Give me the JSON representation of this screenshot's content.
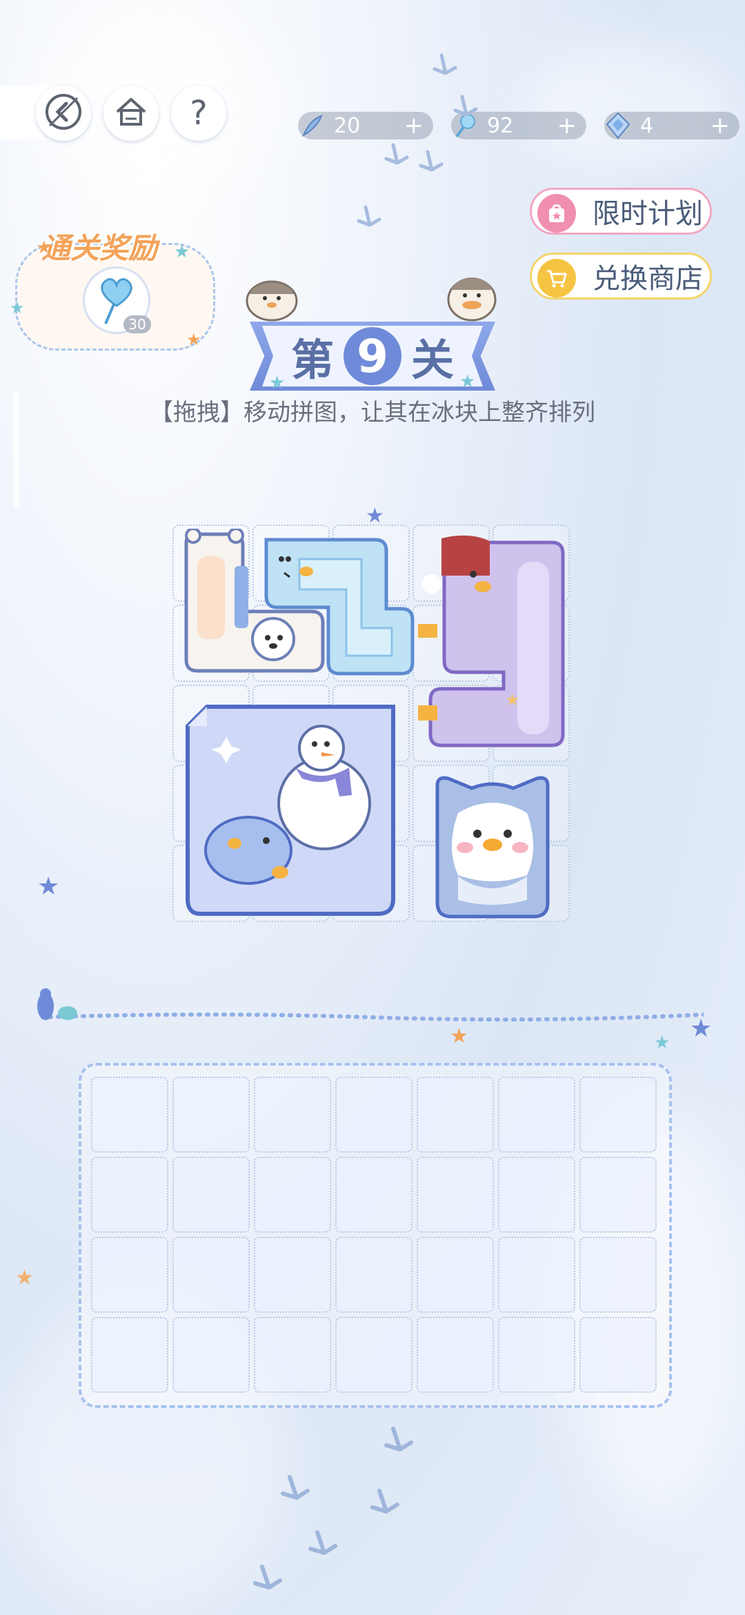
{
  "top_bar": {
    "back_icon": "back-arrow-icon",
    "home_icon": "home-icon",
    "help_label": "?"
  },
  "resources": [
    {
      "name": "feather",
      "icon": "feather-icon",
      "value": "20",
      "plus": "+"
    },
    {
      "name": "lollipop",
      "icon": "lollipop-icon",
      "value": "92",
      "plus": "+"
    },
    {
      "name": "gem",
      "icon": "gem-icon",
      "value": "4",
      "plus": "+"
    }
  ],
  "side_buttons": {
    "limited_plan": "限时计划",
    "exchange_shop": "兑换商店"
  },
  "reward": {
    "title": "通关奖励",
    "item_icon": "heart-lollipop-icon",
    "count": "30"
  },
  "level": {
    "prefix": "第",
    "number": "9",
    "suffix": "关"
  },
  "instruction": "【拖拽】移动拼图，让其在冰块上整齐排列",
  "board": {
    "rows": 5,
    "cols": 5,
    "pieces": [
      {
        "name": "polar-bear-piece",
        "color": "#f7f3ee"
      },
      {
        "name": "blue-snake-piece",
        "color": "#bfe2f5"
      },
      {
        "name": "purple-penguin-piece",
        "color": "#cfc3ee"
      },
      {
        "name": "ice-cube-piece",
        "color": "#cfd9f7"
      },
      {
        "name": "blue-penguin-piece",
        "color": "#a9bfe6"
      }
    ]
  },
  "tray": {
    "rows": 4,
    "cols": 7
  },
  "colors": {
    "accent_blue": "#6f8ad8",
    "reward_orange": "#f3a35a",
    "pink_button_icon": "#f08fb0",
    "yellow_button_icon": "#f5c443"
  }
}
